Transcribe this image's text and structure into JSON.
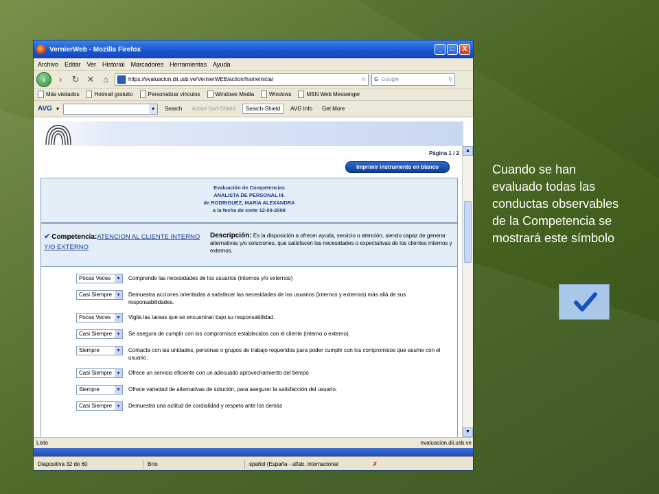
{
  "browser": {
    "title": "VernierWeb - Mozilla Firefox",
    "window_buttons": {
      "minimize": "_",
      "maximize": "□",
      "close": "X"
    },
    "menu": [
      "Archivo",
      "Editar",
      "Ver",
      "Historial",
      "Marcadores",
      "Herramientas",
      "Ayuda"
    ],
    "url": "https://evaluacion.dii.usb.ve/VernierWEB/action/frameInicial",
    "search_placeholder": "Google",
    "bookmarks": [
      "Más visitados",
      "Hotmail gratuito",
      "Personalizar vínculos",
      "Windows Media",
      "Windows",
      "MSN Web Messenger"
    ],
    "avg": {
      "logo": "AVG",
      "search": "Search",
      "active_surf": "Active Surf-Shield",
      "search_shield": "Search-Shield",
      "avg_info": "AVG Info",
      "get_more": "Get More"
    },
    "status_left": "Listo",
    "status_right": "evaluacion.dii.usb.ve"
  },
  "page": {
    "page_number": "Página 1 / 2",
    "print_button": "Imprimir instrumento en blanco",
    "eval": {
      "line1": "Evaluación de Competencias",
      "line2": "ANALISTA DE PERSONAL III.",
      "line3": "de RODRIGUEZ, MARÍA ALEXANDRA",
      "line4": "a la fecha de corte 12-09-2008"
    },
    "competencia": {
      "label": "Competencia:",
      "name": "ATENCION AL CLIENTE INTERNO Y/O EXTERNO",
      "desc_label": "Descripción:",
      "description": "Es la disposición a ofrecer ayuda, servicio o atención, siendo capaz de generar alternativas y/o soluciones, que satisfacen las necesidades o expectativas de los clientes internos y externos."
    },
    "conductas": [
      {
        "value": "Pocas Veces",
        "text": "Comprende las necesidades de los usuarios (internos y/o externos)"
      },
      {
        "value": "Casi Siempre",
        "text": "Demuestra acciones orientadas a satisfacer las necesidades de los usuarios (internos y externos) más allá de sus responsabilidades."
      },
      {
        "value": "Pocas Veces",
        "text": "Vigila las tareas que se encuentran bajo su responsabilidad."
      },
      {
        "value": "Casi Siempre",
        "text": "Se asegura de cumplir con los compromisos establecidos con el cliente (interno o externo)."
      },
      {
        "value": "Siempre",
        "text": "Contacta con las unidades, personas o grupos de trabajo requeridos para poder cumplir con los compromisos que asume con el usuario."
      },
      {
        "value": "Casi Siempre",
        "text": "Ofrece un servicio eficiente con un adecuado aprovechamiento del tiempo"
      },
      {
        "value": "Siempre",
        "text": "Ofrece variedad de alternativas de solución, para asegurar la satisfacción del usuario."
      },
      {
        "value": "Casi Siempre",
        "text": "Demuestra una actitud de cordialidad y respeto ante los demás"
      }
    ]
  },
  "ppt_status": {
    "slide": "Diapositiva 32 de 60",
    "theme": "Brío",
    "language": "spañol (España - alfab. internacional"
  },
  "callout": "Cuando se han evaluado todas las conductas observables de la Competencia se mostrará este símbolo",
  "colors": {
    "check": "#1a5ac8",
    "accent": "#0d3f96"
  }
}
